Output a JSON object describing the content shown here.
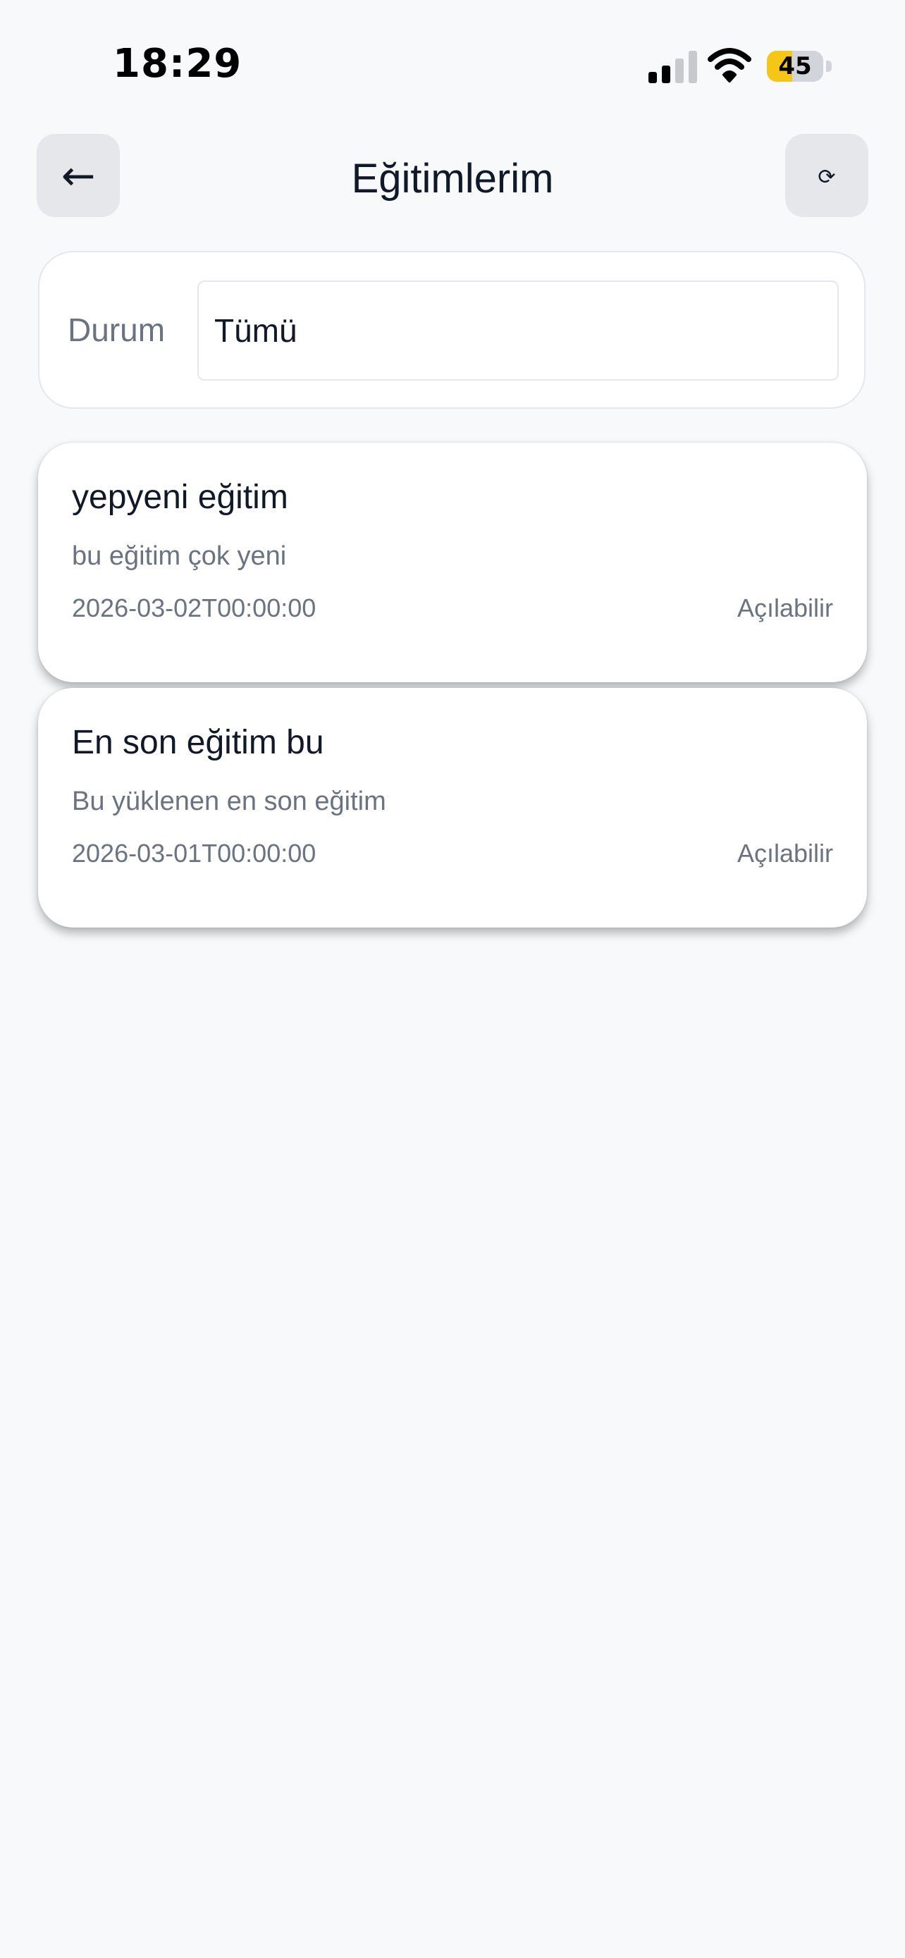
{
  "status_bar": {
    "time": "18:29",
    "battery_percent": "45",
    "battery_level": 0.45
  },
  "header": {
    "title": "Eğitimlerim",
    "back_icon": "arrow-left-icon",
    "refresh_icon": "refresh-icon"
  },
  "filter": {
    "label": "Durum",
    "value": "Tümü"
  },
  "trainings": [
    {
      "title": "yepyeni eğitim",
      "description": "bu eğitim çok yeni",
      "date": "2026-03-02T00:00:00",
      "status": "Açılabilir"
    },
    {
      "title": "En son eğitim bu",
      "description": "Bu yüklenen en son eğitim",
      "date": "2026-03-01T00:00:00",
      "status": "Açılabilir"
    }
  ],
  "colors": {
    "background": "#f8f9fb",
    "card": "#ffffff",
    "muted_text": "#6b7280",
    "battery": "#f5c518"
  }
}
